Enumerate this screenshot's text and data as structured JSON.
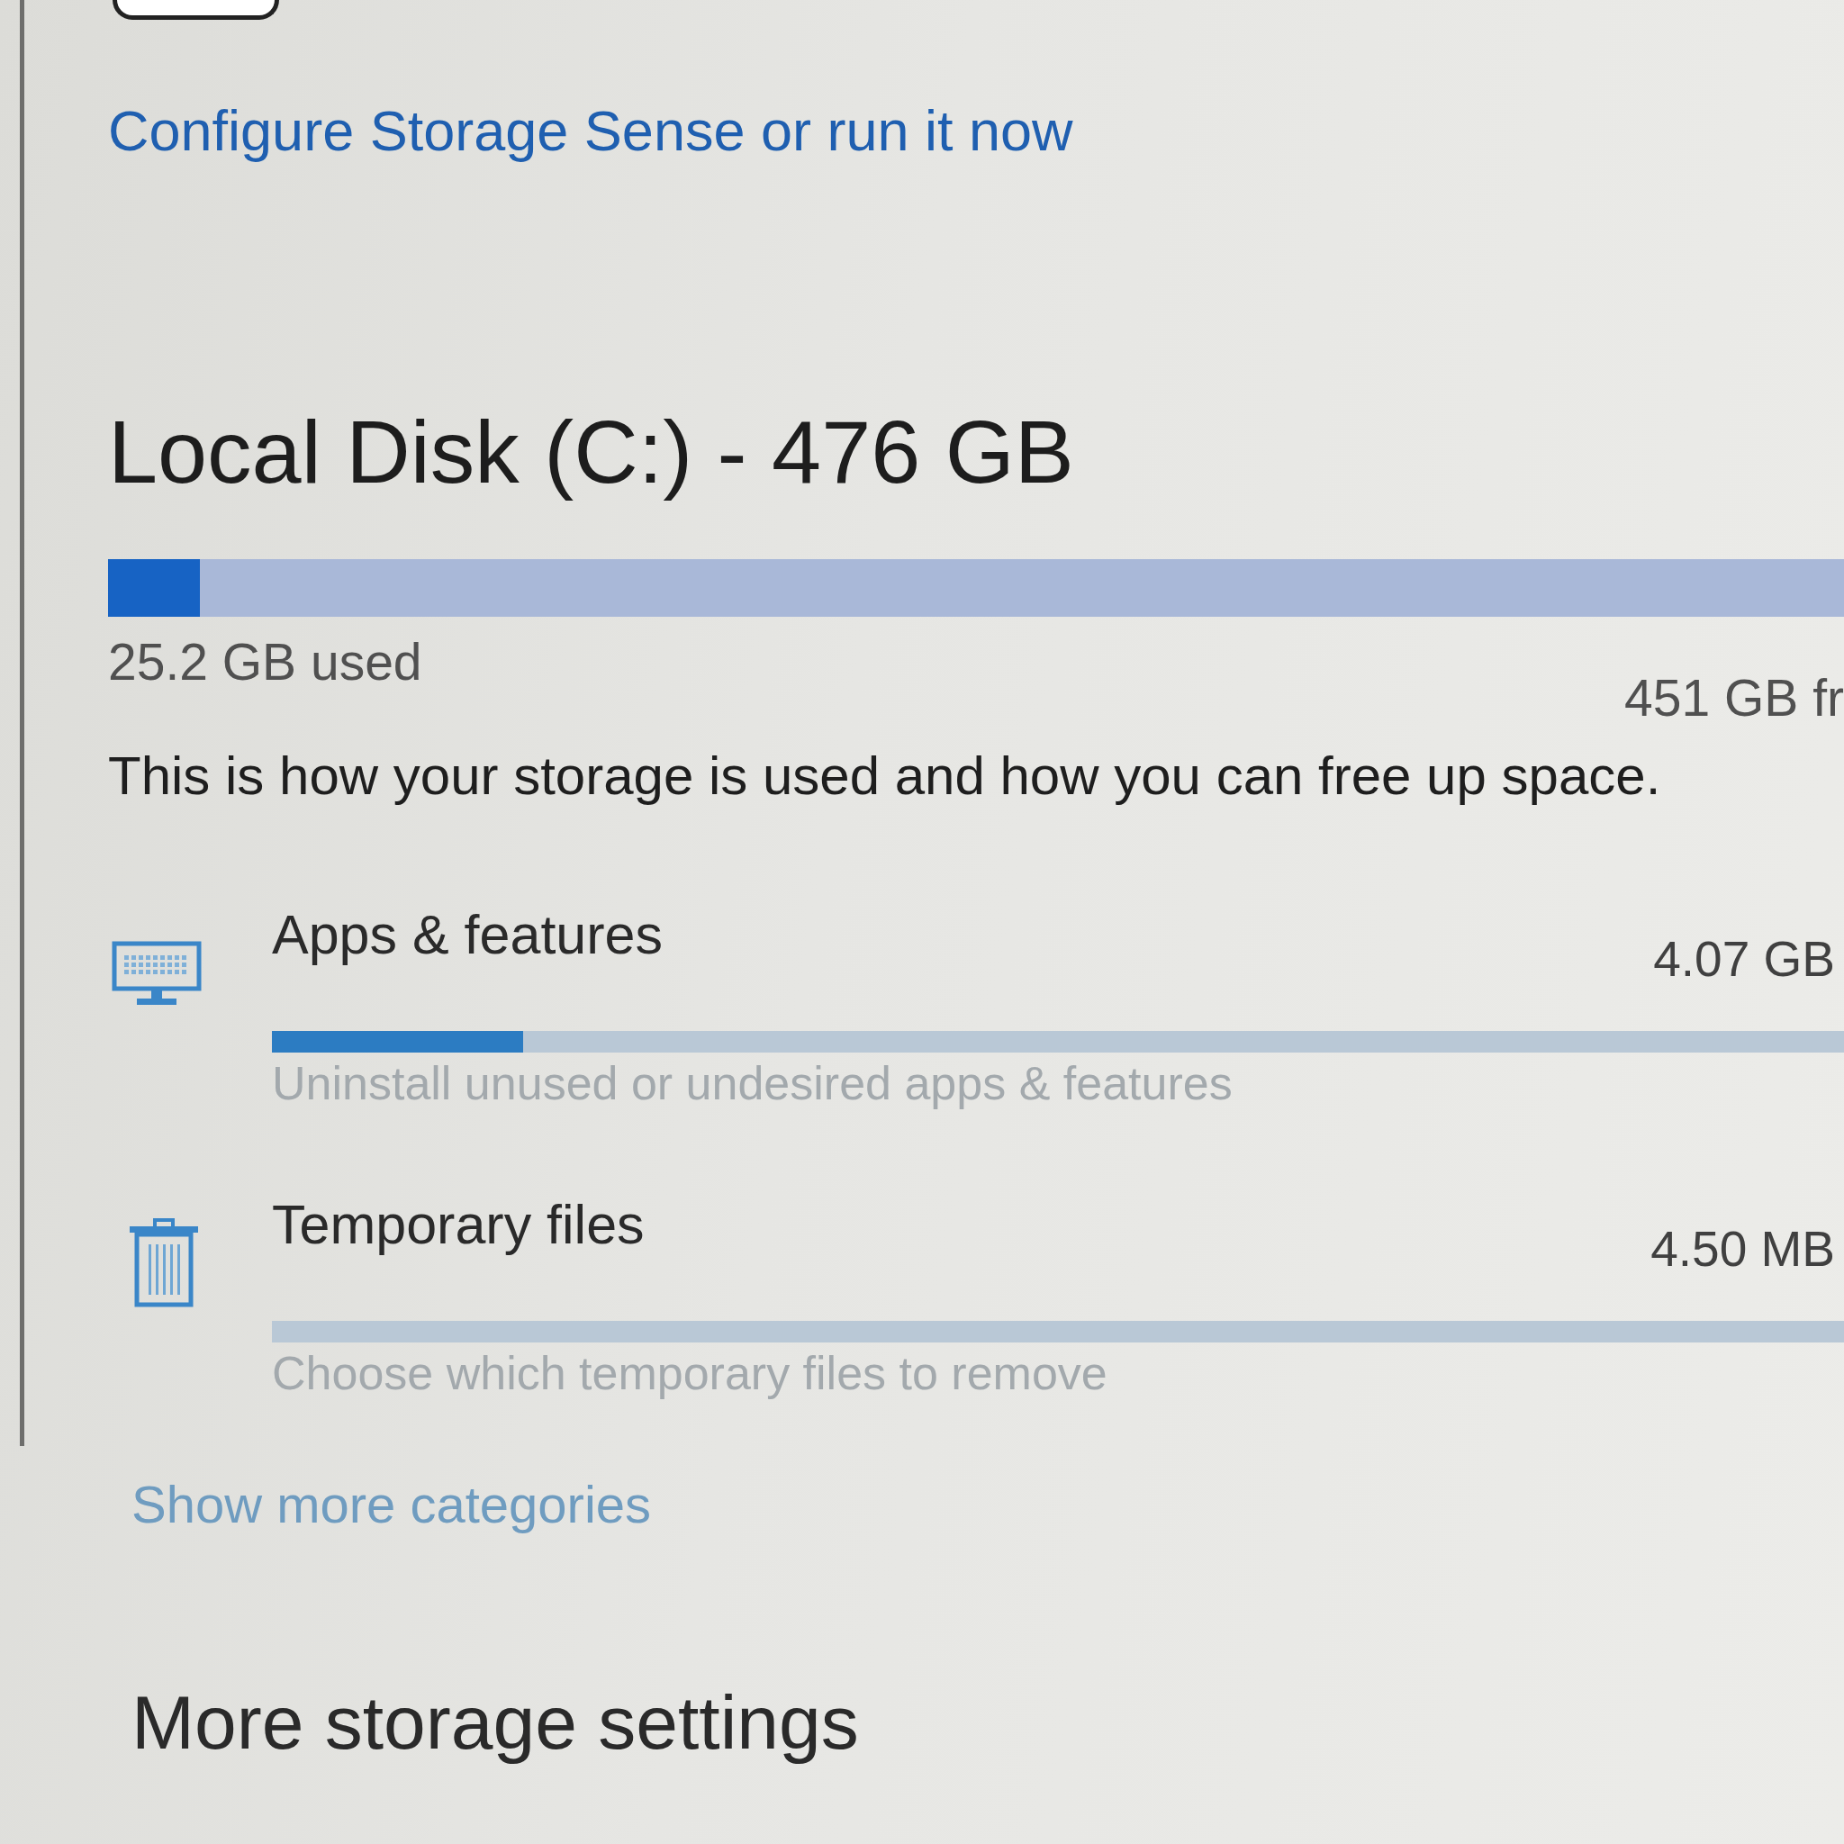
{
  "storage_sense": {
    "on": false
  },
  "configure_link": "Configure Storage Sense or run it now",
  "drive": {
    "title": "Local Disk (C:) - 476 GB",
    "level": 0.053,
    "used": "25.2 GB used",
    "free": "451 GB fr",
    "description": "This is how your storage is used and how you can free up space."
  },
  "categories": [
    {
      "kind": "apps",
      "name": "Apps & features",
      "size": "4.07 GB",
      "level": 0.16,
      "hint": "Uninstall unused or undesired apps & features"
    },
    {
      "kind": "temp",
      "name": "Temporary files",
      "size": "4.50 MB",
      "level": 0,
      "hint": "Choose which temporary files to remove"
    }
  ],
  "show_more_link": "Show more categories",
  "more_settings": {
    "heading": "More storage settings"
  }
}
